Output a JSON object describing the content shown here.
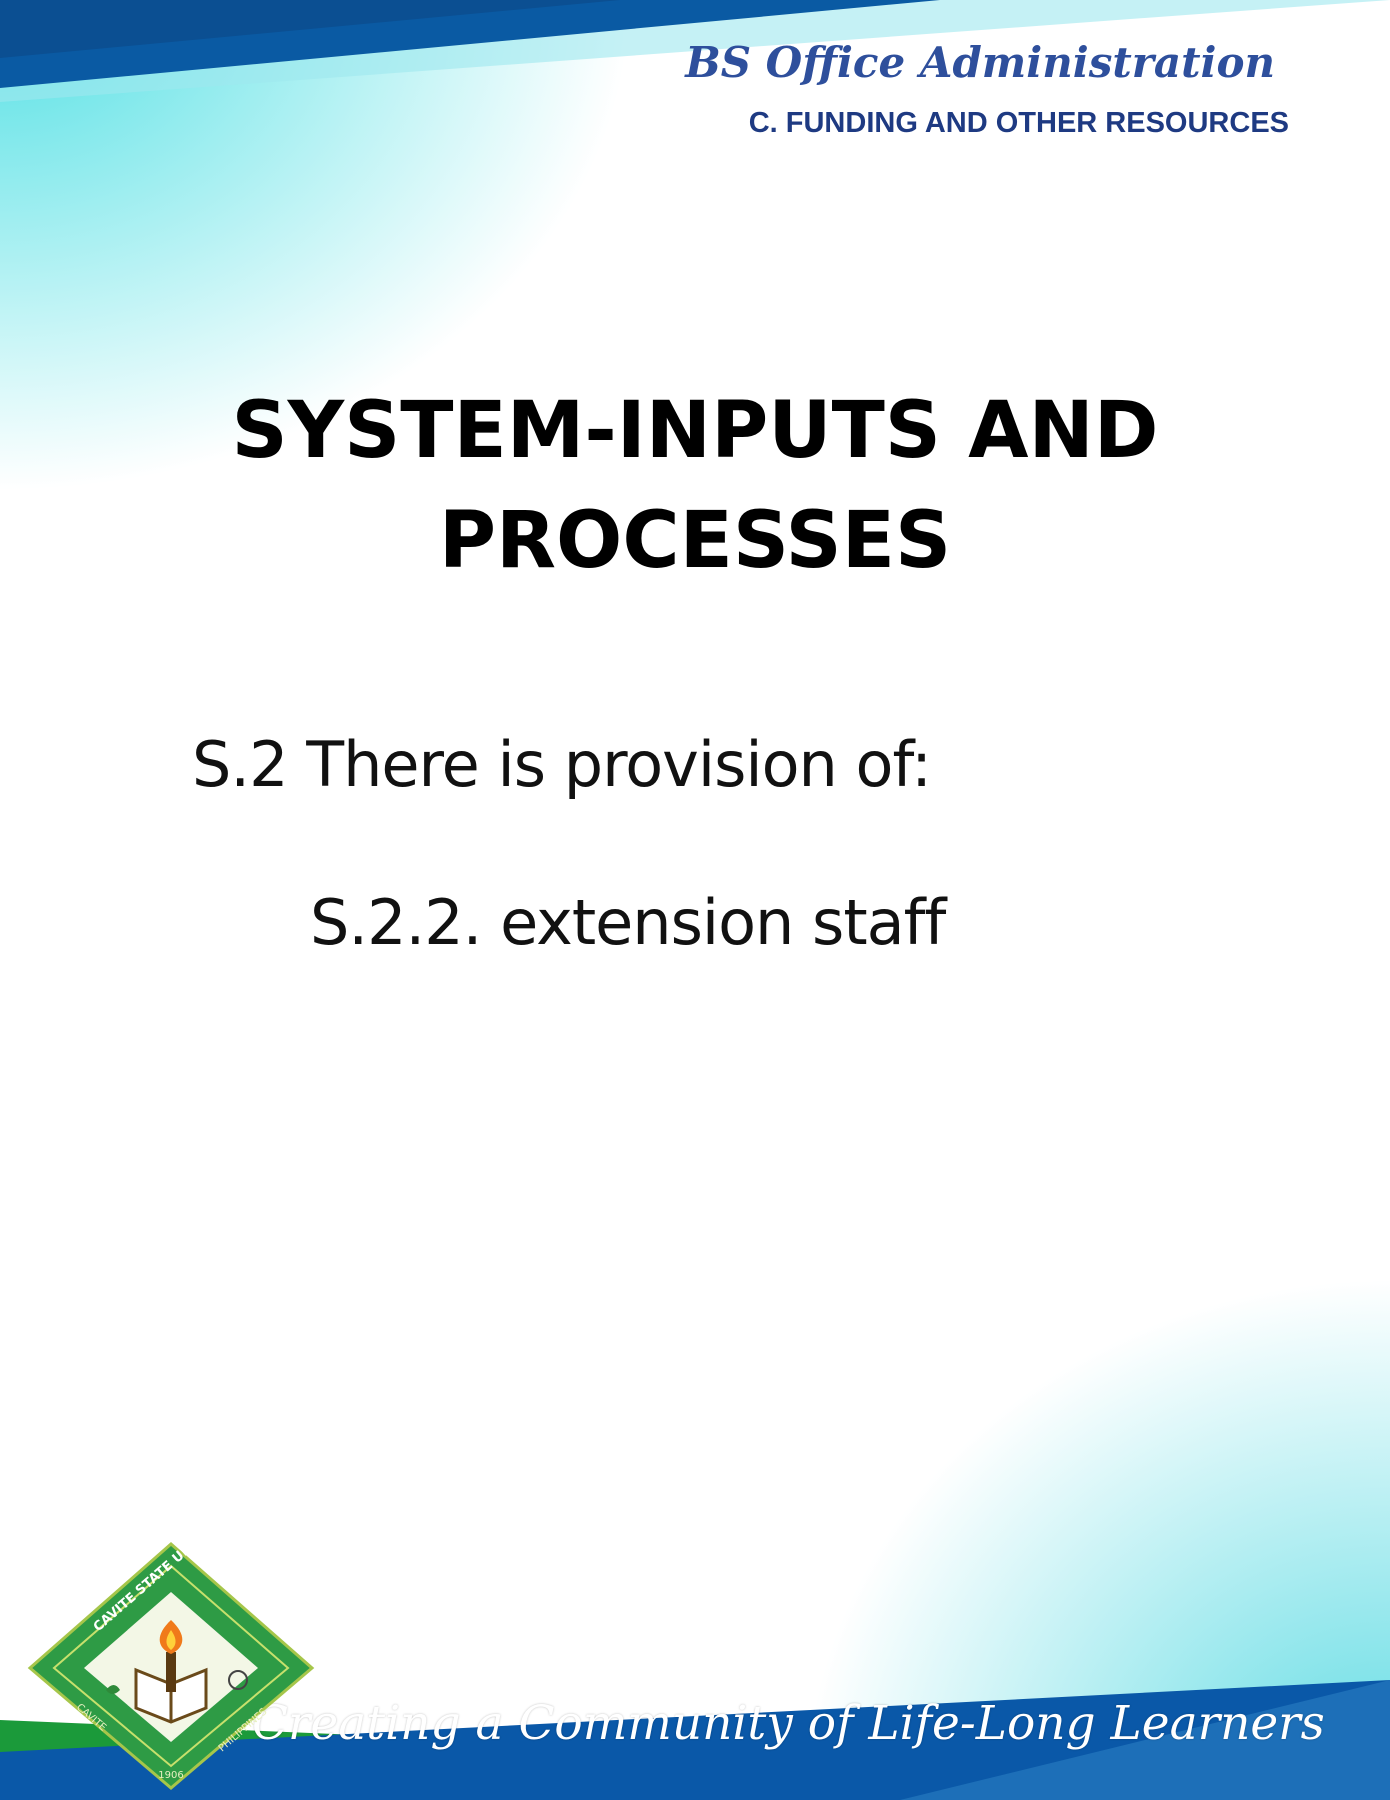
{
  "header": {
    "program": "BS Office Administration",
    "section": "C. FUNDING AND OTHER RESOURCES"
  },
  "main": {
    "title_lines": [
      "SYSTEM-INPUTS AND",
      "PROCESSES"
    ],
    "statement": "S.2 There is provision of:",
    "item": "S.2.2. extension staff"
  },
  "footer": {
    "tagline": "Creating a Community of Life-Long Learners",
    "seal": {
      "icon": "university-seal-icon",
      "text_top": "CAVITE STATE UNIVERSITY",
      "text_left": "CAVITE",
      "text_right": "PHILIPPINES",
      "year": "1906"
    }
  },
  "colors": {
    "top_band": "#0a5aa3",
    "accent_cyan": "#4fe0e6",
    "green_band": "#1b9a3a",
    "blue_band": "#0a58a8",
    "heading_blue": "#2e4f9c"
  }
}
